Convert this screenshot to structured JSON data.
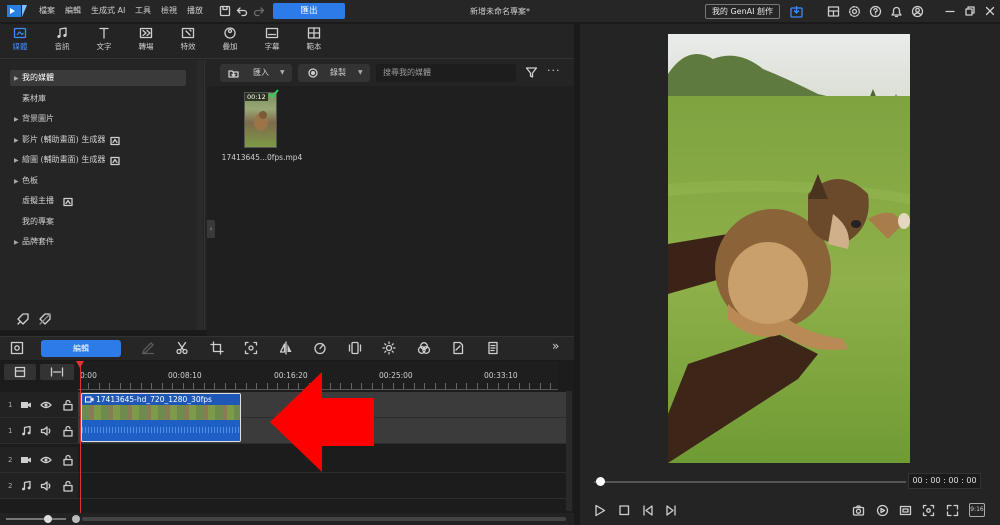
{
  "title_bar": {
    "menus": [
      "檔案",
      "編輯",
      "生成式 AI",
      "工具",
      "檢視",
      "播放"
    ],
    "export_label": "匯出",
    "project_title": "新增未命名專案*",
    "genai_label": "我的 GenAI 創作"
  },
  "rooms": [
    {
      "label": "媒體",
      "icon": "media-icon",
      "active": true
    },
    {
      "label": "音訊",
      "icon": "music-note-icon"
    },
    {
      "label": "文字",
      "icon": "text-icon"
    },
    {
      "label": "轉場",
      "icon": "transition-icon"
    },
    {
      "label": "特效",
      "icon": "effects-icon"
    },
    {
      "label": "疊加",
      "icon": "overlay-icon"
    },
    {
      "label": "字幕",
      "icon": "subtitle-icon"
    },
    {
      "label": "範本",
      "icon": "template-icon"
    }
  ],
  "tree": [
    {
      "label": "我的媒體",
      "arrow": "▶",
      "selected": true
    },
    {
      "label": "素材庫",
      "arrow": ""
    },
    {
      "label": "背景圖片",
      "arrow": "▶"
    },
    {
      "label": "影片 (輔助畫面) 生成器",
      "arrow": "▶",
      "ai": true
    },
    {
      "label": "繪圖 (輔助畫面) 生成器",
      "arrow": "▶",
      "ai": true
    },
    {
      "label": "色板",
      "arrow": "▶"
    },
    {
      "label": "虛擬主播",
      "arrow": "",
      "ai": true
    },
    {
      "label": "我的專案",
      "arrow": ""
    },
    {
      "label": "品牌套件",
      "arrow": "▶"
    }
  ],
  "library": {
    "import_label": "匯入",
    "record_label": "錄製",
    "search_placeholder": "搜尋我的媒體",
    "media_items": [
      {
        "name": "17413645...0fps.mp4",
        "duration": "00:12"
      }
    ]
  },
  "preview": {
    "timecode": "00 : 00 : 00 : 00",
    "aspect": "9:16"
  },
  "edit_toolbar": {
    "edit_label": "編輯"
  },
  "timeline": {
    "ruler_labels": [
      "0:00",
      "00:08:10",
      "00:16:20",
      "00:25:00",
      "00:33:10"
    ],
    "tracks": [
      {
        "num": "1",
        "type": "video"
      },
      {
        "num": "1",
        "type": "audio"
      },
      {
        "num": "2",
        "type": "video"
      },
      {
        "num": "2",
        "type": "audio"
      }
    ],
    "clip_title": "17413645-hd_720_1280_30fps"
  },
  "colors": {
    "accent": "#2d7be8",
    "playhead": "#e53030",
    "annotation_arrow": "#ff0000"
  }
}
